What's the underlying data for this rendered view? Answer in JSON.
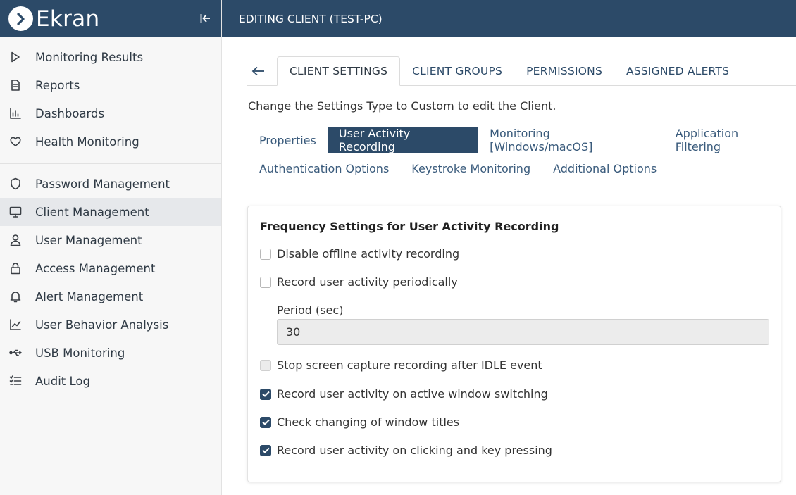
{
  "brand": {
    "name": "Ekran"
  },
  "sidebar": {
    "group1": [
      {
        "label": "Monitoring Results",
        "icon": "play-icon"
      },
      {
        "label": "Reports",
        "icon": "document-icon"
      },
      {
        "label": "Dashboards",
        "icon": "bar-chart-icon"
      },
      {
        "label": "Health Monitoring",
        "icon": "heart-icon"
      }
    ],
    "group2": [
      {
        "label": "Password Management",
        "icon": "shield-icon"
      },
      {
        "label": "Client Management",
        "icon": "monitor-icon",
        "active": true
      },
      {
        "label": "User Management",
        "icon": "user-icon"
      },
      {
        "label": "Access Management",
        "icon": "lock-icon"
      },
      {
        "label": "Alert Management",
        "icon": "bell-icon"
      },
      {
        "label": "User Behavior Analysis",
        "icon": "trend-icon"
      },
      {
        "label": "USB Monitoring",
        "icon": "usb-icon"
      },
      {
        "label": "Audit Log",
        "icon": "checklist-icon"
      }
    ]
  },
  "header": {
    "title": "EDITING CLIENT (TEST-PC)"
  },
  "tabs": [
    "CLIENT SETTINGS",
    "CLIENT GROUPS",
    "PERMISSIONS",
    "ASSIGNED ALERTS"
  ],
  "hint": "Change the Settings Type to Custom to edit the Client.",
  "subtabs": {
    "row1": [
      "Properties",
      "User Activity Recording",
      "Monitoring [Windows/macOS]",
      "Application Filtering"
    ],
    "row2": [
      "Authentication Options",
      "Keystroke Monitoring",
      "Additional Options"
    ]
  },
  "card": {
    "title": "Frequency Settings for User Activity Recording",
    "options": {
      "disable_offline": {
        "label": "Disable offline activity recording",
        "checked": false
      },
      "periodic": {
        "label": "Record user activity periodically",
        "checked": false
      },
      "stop_idle": {
        "label": "Stop screen capture recording after IDLE event",
        "checked": false,
        "disabled": true
      },
      "window_switch": {
        "label": "Record user activity on active window switching",
        "checked": true
      },
      "window_titles": {
        "label": "Check changing of window titles",
        "checked": true
      },
      "click_key": {
        "label": "Record user activity on clicking and key pressing",
        "checked": true
      }
    },
    "period": {
      "label": "Period (sec)",
      "value": "30"
    }
  },
  "colors": {
    "primary": "#2c4a68",
    "sidebar_bg": "#f7f7f7",
    "active_item_bg": "#e6e8eb"
  }
}
